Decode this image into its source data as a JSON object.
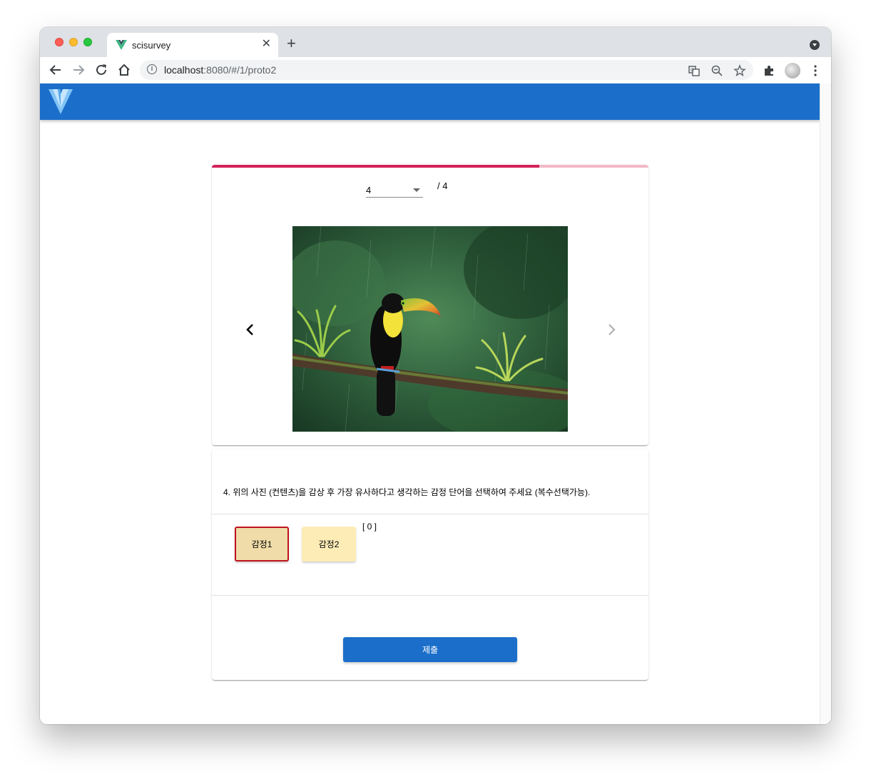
{
  "browser": {
    "tab_title": "scisurvey",
    "url_host": "localhost",
    "url_path": ":8080/#/1/proto2"
  },
  "survey": {
    "current_page": "4",
    "total_pages": "/ 4",
    "progress_percent": 75,
    "question": "4. 위의 사진 (컨텐츠)을 감상 후 가장 유사하다고 생각하는 감정 단어을 선택하여 주세요 (복수선택가능).",
    "emotions": [
      {
        "label": "감정1",
        "selected": true
      },
      {
        "label": "감정2",
        "selected": false
      }
    ],
    "selected_count": "[ 0 ]",
    "submit_label": "제출"
  },
  "colors": {
    "appbar": "#1b6fca",
    "progress": "#d4215a",
    "submit": "#1b6fca"
  }
}
